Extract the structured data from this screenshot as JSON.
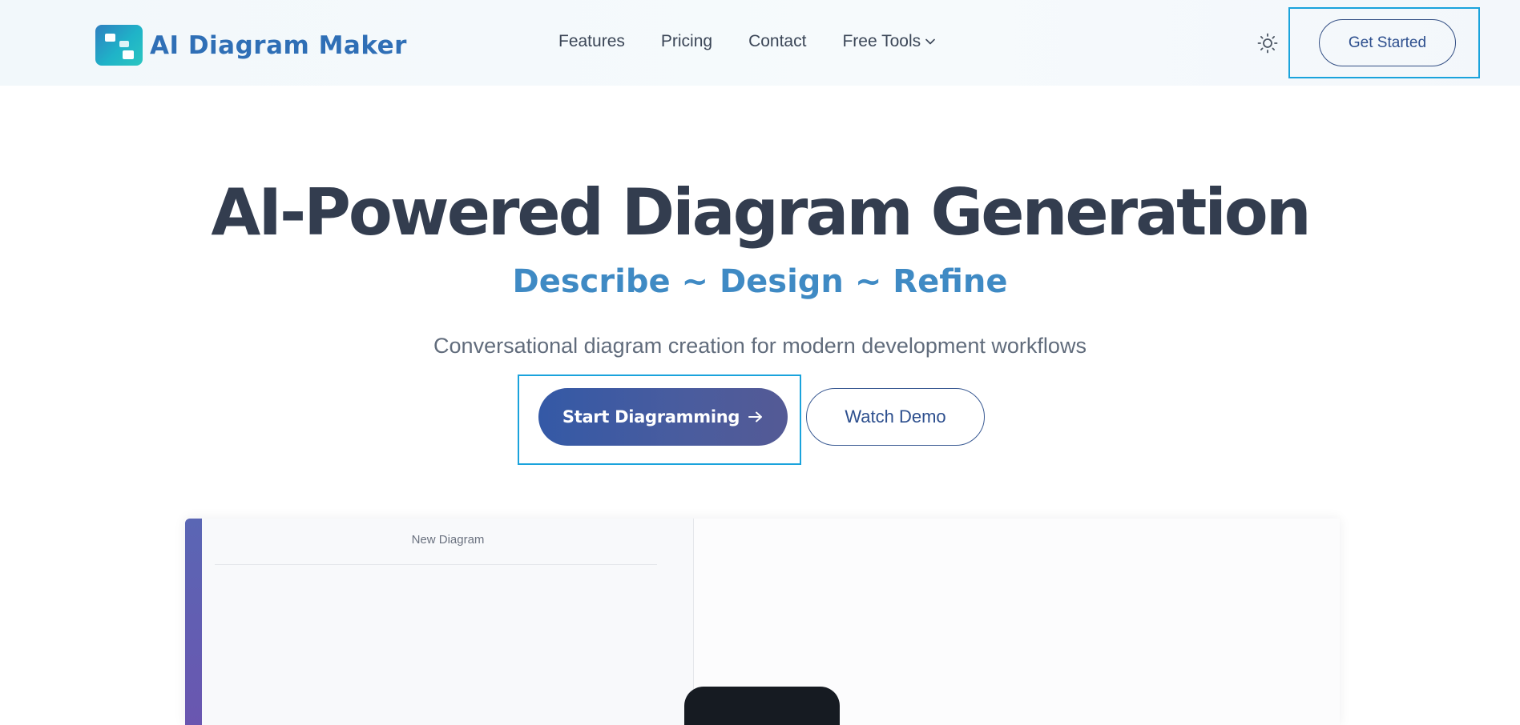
{
  "brand": {
    "name": "AI Diagram Maker",
    "logo_icon": "diagram-logo-icon",
    "accent": "#2f6fb6"
  },
  "nav": {
    "items": [
      {
        "label": "Features"
      },
      {
        "label": "Pricing"
      },
      {
        "label": "Contact"
      },
      {
        "label": "Free Tools",
        "icon": "chevron-down-icon"
      }
    ]
  },
  "header": {
    "theme_icon": "sun-icon",
    "cta_label": "Get Started"
  },
  "hero": {
    "title": "AI-Powered Diagram Generation",
    "subtitle": "Describe ~ Design ~ Refine",
    "description": "Conversational diagram creation for modern development workflows",
    "primary_cta": "Start Diagramming",
    "primary_cta_icon": "arrow-right-icon",
    "secondary_cta": "Watch Demo"
  },
  "preview": {
    "panel_title": "New Diagram"
  },
  "colors": {
    "primary_button": "#3459a6",
    "subtitle": "#3f8ac4",
    "heading": "#333d4f",
    "focus_outline": "#1aa3dc"
  }
}
